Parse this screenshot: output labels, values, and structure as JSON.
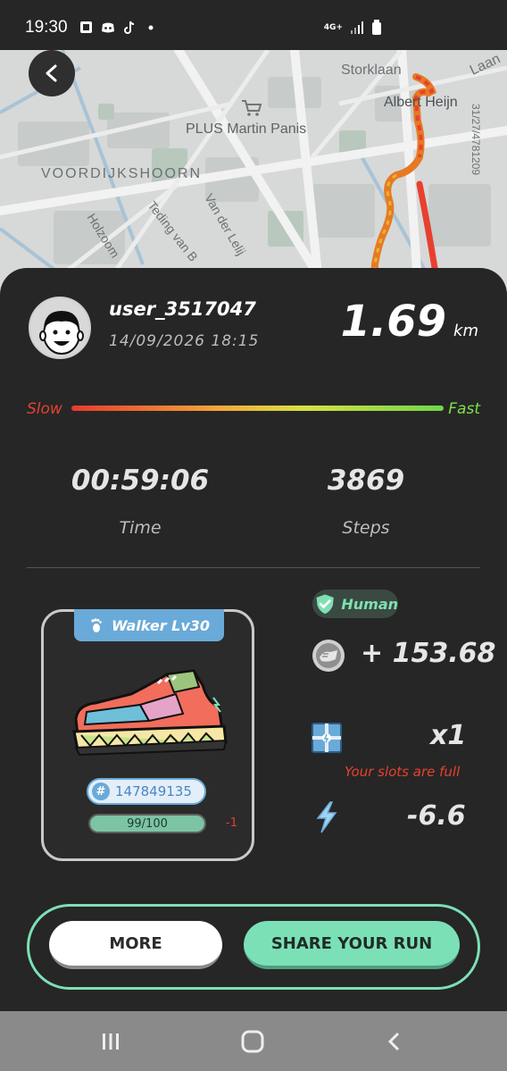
{
  "status_bar": {
    "time": "19:30",
    "network": "4G+"
  },
  "map": {
    "labels": {
      "storklaan": "Storklaan",
      "laan": "Laan",
      "albert_heijn": "Albert Heijn",
      "plus": "PLUS Martin Panis",
      "voordijkshoorn": "VOORDIJKSHOORN",
      "holzoom": "Holzoom",
      "teding": "Teding van B",
      "lelij": "Van der Lelij",
      "vertical": "31/27/4781209"
    }
  },
  "run": {
    "username": "user_3517047",
    "datetime": "14/09/2026 18:15",
    "distance": "1.69",
    "distance_unit": "km",
    "slow_label": "Slow",
    "fast_label": "Fast",
    "time_value": "00:59:06",
    "time_label": "Time",
    "steps_value": "3869",
    "steps_label": "Steps"
  },
  "sneaker": {
    "name": "Walker Lv30",
    "id": "147849135",
    "durability": "99/100",
    "durability_delta": "-1"
  },
  "rewards": {
    "badge": "Human",
    "token_reward": "+ 153.68",
    "box_count": "x1",
    "slots_message": "Your slots are full",
    "energy": "-6.6"
  },
  "actions": {
    "more_label": "MORE",
    "share_label": "SHARE YOUR RUN"
  },
  "colors": {
    "accent": "#7ce0b7",
    "slow": "#e8402f",
    "fast": "#7be24a",
    "sneaker_blue": "#6aaad8"
  }
}
